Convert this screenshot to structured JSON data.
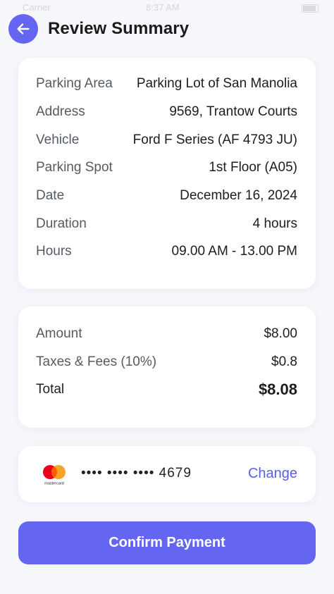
{
  "status_bar": {
    "carrier": "Carrier",
    "time": "8:37 AM"
  },
  "header": {
    "title": "Review Summary"
  },
  "details": [
    {
      "label": "Parking Area",
      "value": "Parking Lot of San Manolia"
    },
    {
      "label": "Address",
      "value": "9569, Trantow Courts"
    },
    {
      "label": "Vehicle",
      "value": "Ford F Series (AF 4793 JU)"
    },
    {
      "label": "Parking Spot",
      "value": "1st Floor (A05)"
    },
    {
      "label": "Date",
      "value": "December 16, 2024"
    },
    {
      "label": "Duration",
      "value": "4 hours"
    },
    {
      "label": "Hours",
      "value": "09.00 AM - 13.00 PM"
    }
  ],
  "costs": {
    "amount": {
      "label": "Amount",
      "value": "$8.00"
    },
    "taxes": {
      "label": "Taxes & Fees (10%)",
      "value": "$0.8"
    },
    "total": {
      "label": "Total",
      "value": "$8.08"
    }
  },
  "payment": {
    "brand_text": "mastercard",
    "card_number": "•••• •••• •••• 4679",
    "change_label": "Change"
  },
  "confirm_label": "Confirm Payment",
  "colors": {
    "accent": "#6466f1",
    "link": "#5b5de8",
    "mc_red": "#eb001b",
    "mc_orange": "#f79e1b"
  }
}
